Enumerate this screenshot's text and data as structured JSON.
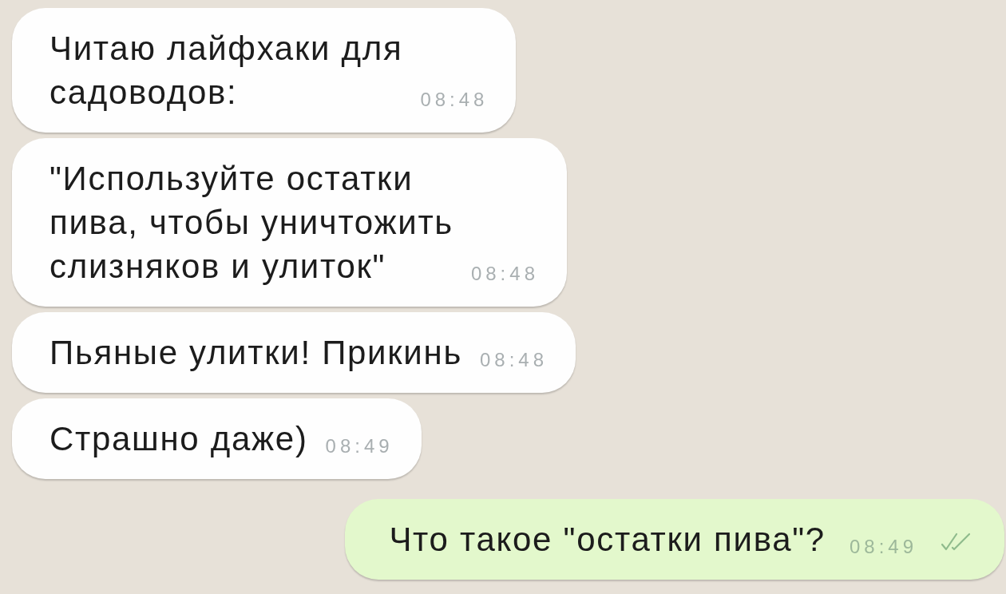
{
  "messages": [
    {
      "kind": "incoming",
      "text": "Читаю лайфхаки для\nсадоводов:",
      "time": "08:48"
    },
    {
      "kind": "incoming",
      "text": "\"Используйте остатки\nпива, чтобы уничтожить\nслизняков и улиток\"",
      "time": "08:48"
    },
    {
      "kind": "incoming",
      "text": "Пьяные улитки! Прикинь",
      "time": "08:48"
    },
    {
      "kind": "incoming",
      "text": "Страшно даже)",
      "time": "08:49"
    },
    {
      "kind": "outgoing",
      "text": "Что такое \"остатки пива\"?",
      "time": "08:49"
    }
  ]
}
